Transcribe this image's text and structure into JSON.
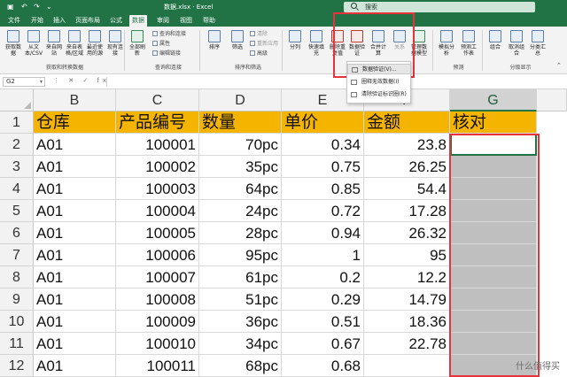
{
  "titlebar": {
    "undo_glyph": "↶",
    "redo_glyph": "↷",
    "more_glyph": "⌄",
    "title": "数据.xlsx  ·  Excel",
    "search_placeholder": "搜索"
  },
  "tabs": [
    "文件",
    "开始",
    "插入",
    "页面布局",
    "公式",
    "数据",
    "审阅",
    "视图",
    "帮助"
  ],
  "active_tab": "数据",
  "ribbon": {
    "get_data": [
      "获取数据",
      "从文本/CSV",
      "来自网站",
      "来自表格/区域",
      "最近使用的源",
      "现有连接"
    ],
    "get_group_label": "获取和转换数据",
    "refresh_all": "全部刷新",
    "query_items": [
      "查询和连接",
      "属性",
      "编辑链接"
    ],
    "query_group_label": "查询和连接",
    "sort_buttons": [
      "排序",
      "筛选"
    ],
    "sort_small": [
      "清除",
      "重新应用",
      "高级"
    ],
    "sort_group_label": "排序和筛选",
    "tools_buttons": [
      "分列",
      "快速填充",
      "删除重复值",
      "数据验证",
      "合并计算",
      "关系",
      "管理数据模型"
    ],
    "forecast_buttons": [
      "模拟分析",
      "预测工作表"
    ],
    "forecast_group_label": "预测",
    "outline_buttons": [
      "组合",
      "取消组合",
      "分类汇总"
    ],
    "outline_group_label": "分级显示",
    "collapse_glyph": "⌃"
  },
  "dropdown": {
    "items": [
      "数据验证(V)...",
      "圈释无效数据(I)",
      "清除验证标识圈(R)"
    ]
  },
  "formula_bar": {
    "name_box": "G2",
    "name_dd_glyph": "▾",
    "fx_icons": "⋮ ✕ ✓ fx",
    "formula": ""
  },
  "grid": {
    "columns": [
      "B",
      "C",
      "D",
      "E",
      "F",
      "G"
    ],
    "selected_column": "G",
    "rows": [
      "1",
      "2",
      "3",
      "4",
      "5",
      "6",
      "7",
      "8",
      "9",
      "10",
      "11",
      "12"
    ],
    "headers": [
      "仓库",
      "产品编号",
      "数量",
      "单价",
      "金额",
      "核对"
    ],
    "data": [
      [
        "A01",
        "100001",
        "70pc",
        "0.34",
        "23.8",
        ""
      ],
      [
        "A01",
        "100002",
        "35pc",
        "0.75",
        "26.25",
        ""
      ],
      [
        "A01",
        "100003",
        "64pc",
        "0.85",
        "54.4",
        ""
      ],
      [
        "A01",
        "100004",
        "24pc",
        "0.72",
        "17.28",
        ""
      ],
      [
        "A01",
        "100005",
        "28pc",
        "0.94",
        "26.32",
        ""
      ],
      [
        "A01",
        "100006",
        "95pc",
        "1",
        "95",
        ""
      ],
      [
        "A01",
        "100007",
        "61pc",
        "0.2",
        "12.2",
        ""
      ],
      [
        "A01",
        "100008",
        "51pc",
        "0.29",
        "14.79",
        ""
      ],
      [
        "A01",
        "100009",
        "36pc",
        "0.51",
        "18.36",
        ""
      ],
      [
        "A01",
        "100010",
        "34pc",
        "0.67",
        "22.78",
        ""
      ],
      [
        "A01",
        "100011",
        "68pc",
        "0.68",
        "",
        ""
      ]
    ]
  },
  "watermark": "什么值得买",
  "colors": {
    "excel_green": "#217346",
    "header_fill": "#f5b400",
    "highlight_red": "#e8323c"
  }
}
